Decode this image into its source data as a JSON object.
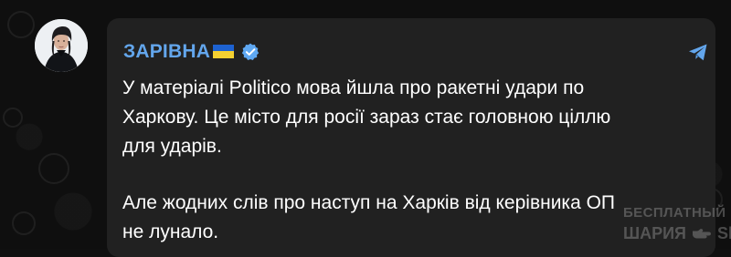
{
  "channel": {
    "name": "ЗАРІВНА",
    "flag_icon": "ukraine-flag-icon",
    "verified_icon": "verified-badge-icon",
    "share_icon": "telegram-share-icon",
    "colors": {
      "name": "#63a6ec",
      "verified": "#5fa8f2",
      "bubble": "#212121",
      "background": "#0f0f0f"
    }
  },
  "message": {
    "paragraphs": [
      "У матеріалі Politico мова йшла про ракетні удари по\nХаркову. Це місто для росії зараз стає головною ціллю\nдля ударів.",
      "Але жодних слів про наступ на Харків від керівника ОП\nне лунало."
    ]
  },
  "watermark": {
    "top_text": "БЕСПЛАТНЫЙ НАСТОЯЩИЙ",
    "brand": "ШАРИЯ",
    "site": "Sharij.net",
    "hand_icon": "pointing-hand-icon"
  },
  "avatar": {
    "icon": "channel-avatar"
  }
}
